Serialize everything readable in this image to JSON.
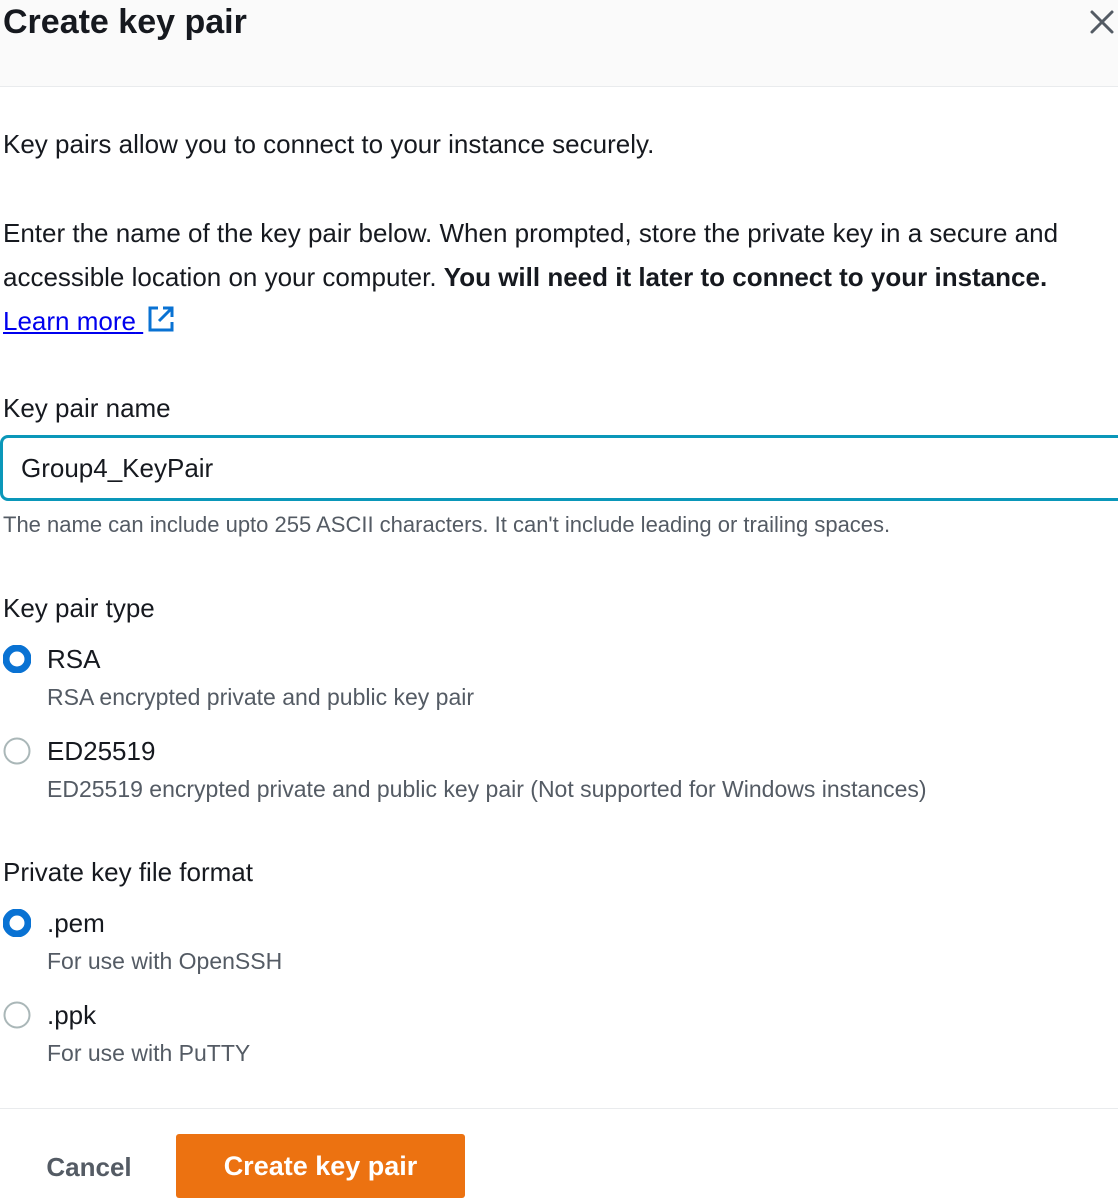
{
  "dialog": {
    "title": "Create key pair",
    "close_icon": "close-icon"
  },
  "intro": "Key pairs allow you to connect to your instance securely.",
  "description": {
    "text": "Enter the name of the key pair below. When prompted, store the private key in a secure and accessible location on your computer. ",
    "bold": "You will need it later to connect to your instance.",
    "link": "Learn more",
    "link_icon": "external-link-icon"
  },
  "key_pair_name": {
    "label": "Key pair name",
    "value": "Group4_KeyPair",
    "hint": "The name can include upto 255 ASCII characters. It can't include leading or trailing spaces."
  },
  "key_pair_type": {
    "label": "Key pair type",
    "options": [
      {
        "label": "RSA",
        "description": "RSA encrypted private and public key pair",
        "selected": true
      },
      {
        "label": "ED25519",
        "description": "ED25519 encrypted private and public key pair (Not supported for Windows instances)",
        "selected": false
      }
    ]
  },
  "file_format": {
    "label": "Private key file format",
    "options": [
      {
        "label": ".pem",
        "description": "For use with OpenSSH",
        "selected": true
      },
      {
        "label": ".ppk",
        "description": "For use with PuTTY",
        "selected": false
      }
    ]
  },
  "footer": {
    "cancel_label": "Cancel",
    "create_label": "Create key pair"
  },
  "colors": {
    "primary_button": "#ec7211",
    "input_focus_border": "#0a97b9",
    "radio_selected": "#0972d3",
    "link": "#0000ee"
  }
}
